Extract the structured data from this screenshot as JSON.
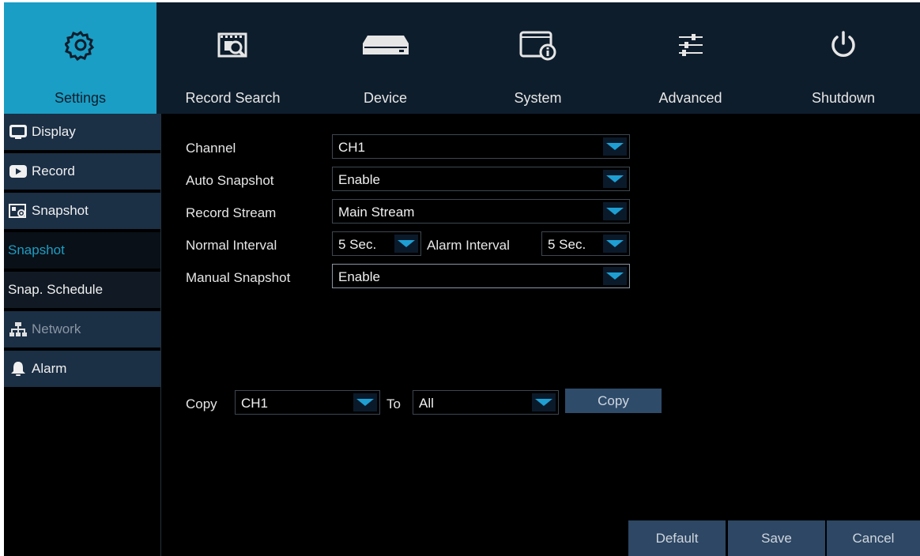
{
  "topnav": {
    "tabs": [
      {
        "label": "Settings",
        "icon": "gear-icon",
        "active": true
      },
      {
        "label": "Record Search",
        "icon": "record-search-icon"
      },
      {
        "label": "Device",
        "icon": "hard-drive-icon"
      },
      {
        "label": "System",
        "icon": "system-info-icon"
      },
      {
        "label": "Advanced",
        "icon": "sliders-icon"
      },
      {
        "label": "Shutdown",
        "icon": "power-icon"
      }
    ]
  },
  "sidebar": {
    "items": [
      {
        "label": "Display",
        "icon": "monitor-icon"
      },
      {
        "label": "Record",
        "icon": "record-icon"
      },
      {
        "label": "Snapshot",
        "icon": "snapshot-icon"
      }
    ],
    "subitems": [
      {
        "label": "Snapshot",
        "active": true
      },
      {
        "label": "Snap. Schedule"
      }
    ],
    "items2": [
      {
        "label": "Network",
        "icon": "network-icon",
        "disabled": true
      },
      {
        "label": "Alarm",
        "icon": "bell-icon"
      }
    ]
  },
  "form": {
    "channel": {
      "label": "Channel",
      "value": "CH1"
    },
    "auto_snapshot": {
      "label": "Auto Snapshot",
      "value": "Enable"
    },
    "record_stream": {
      "label": "Record Stream",
      "value": "Main Stream"
    },
    "normal_interval": {
      "label": "Normal Interval",
      "value": "5 Sec."
    },
    "alarm_interval": {
      "label": "Alarm Interval",
      "value": "5 Sec."
    },
    "manual_snapshot": {
      "label": "Manual Snapshot",
      "value": "Enable"
    }
  },
  "copy": {
    "label": "Copy",
    "from_value": "CH1",
    "to_label": "To",
    "to_value": "All",
    "button": "Copy"
  },
  "buttons": {
    "default": "Default",
    "save": "Save",
    "cancel": "Cancel"
  },
  "colors": {
    "accent": "#1a9ec5",
    "nav_bg": "#0e1d2c",
    "sidebar_item_bg": "#1b2f45",
    "button_bg": "#2d4764"
  }
}
